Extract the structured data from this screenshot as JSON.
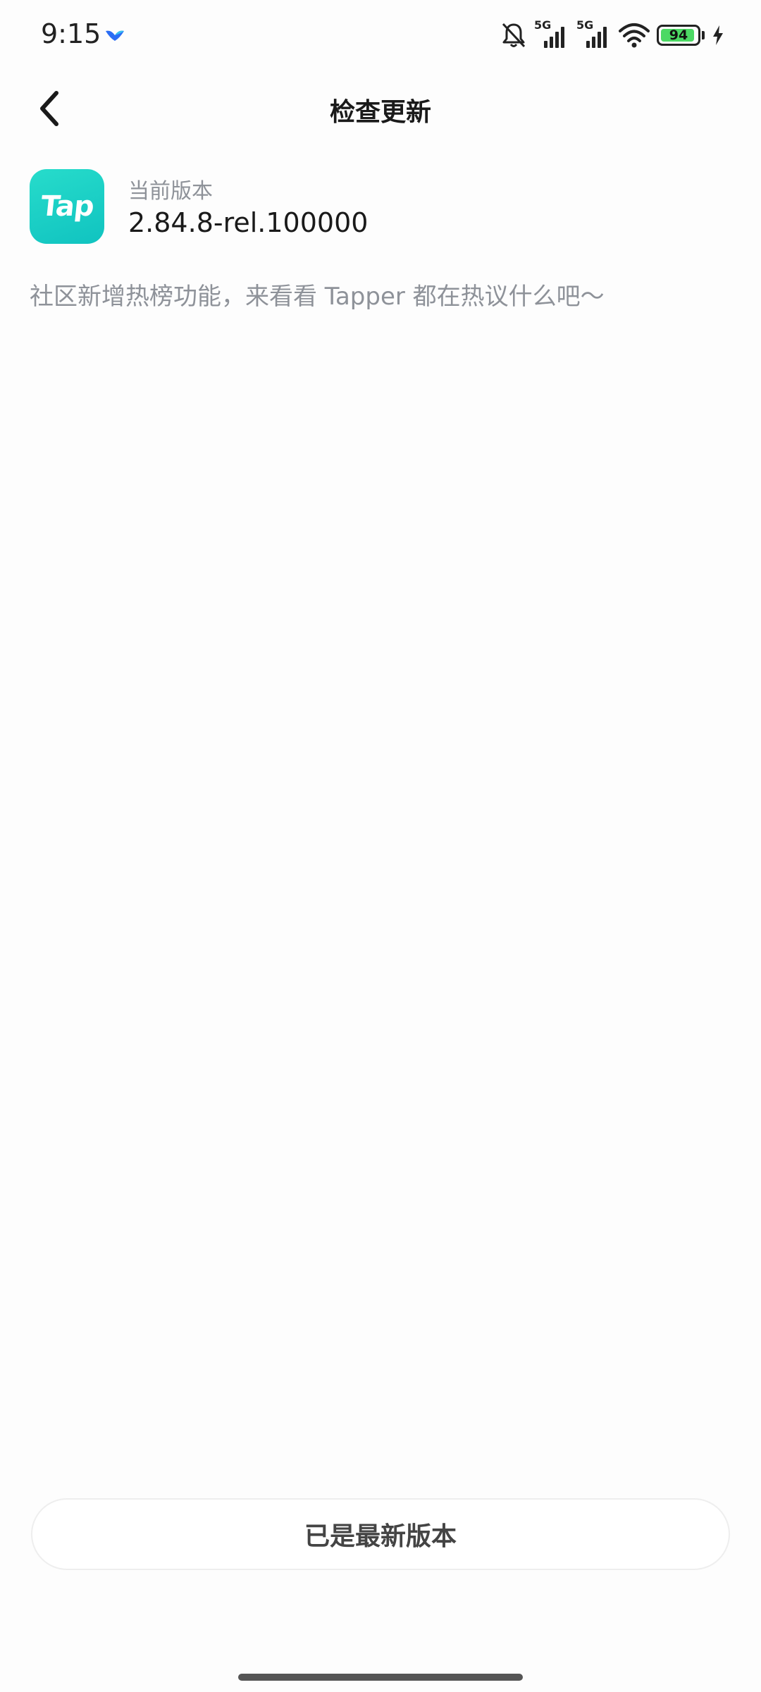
{
  "status_bar": {
    "time": "9:15",
    "network_1": "5G",
    "network_2": "5G",
    "battery": "94",
    "battery_fraction": 0.94
  },
  "header": {
    "title": "检查更新"
  },
  "app": {
    "logo_text": "Tap",
    "version_label": "当前版本",
    "version_value": "2.84.8-rel.100000"
  },
  "release_notes": "社区新增热榜功能，来看看 Tapper 都在热议什么吧～",
  "footer": {
    "button_label": "已是最新版本"
  },
  "colors": {
    "accent": "#13c7c2",
    "battery_fill": "#4cd964"
  }
}
